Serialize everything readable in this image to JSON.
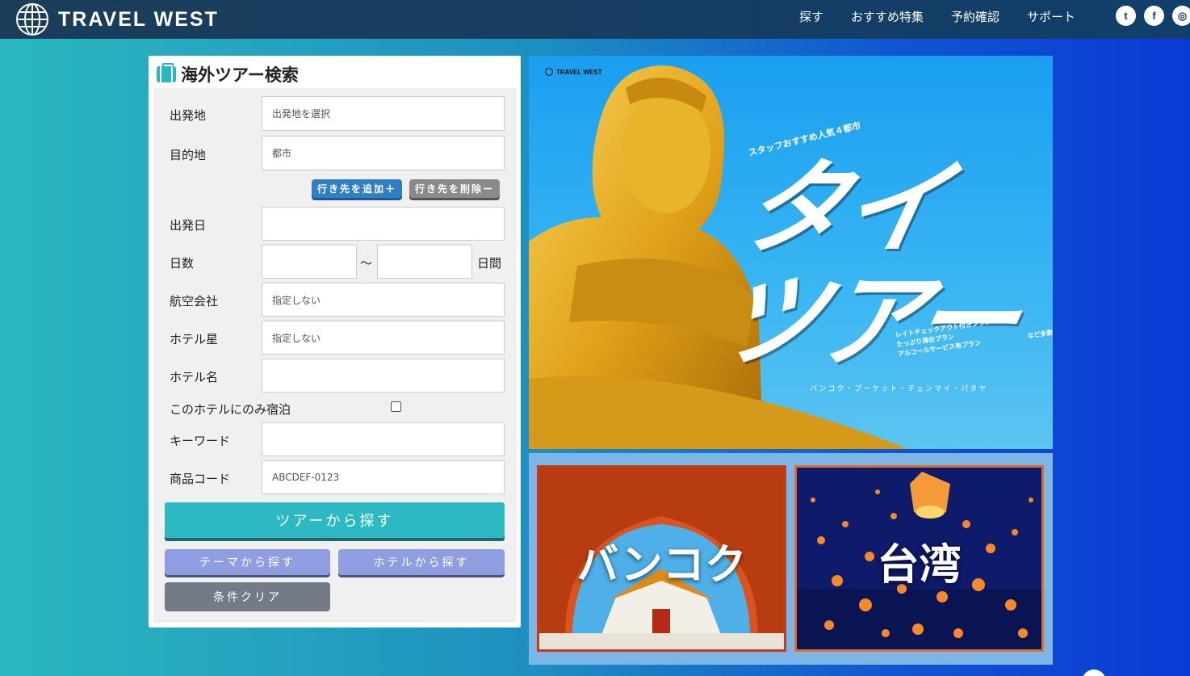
{
  "header": {
    "logo_text": "TRAVEL WEST",
    "nav": [
      "探す",
      "おすすめ特集",
      "予約確認",
      "サポート"
    ],
    "social": [
      {
        "icon": "twitter-icon",
        "glyph": "t"
      },
      {
        "icon": "facebook-icon",
        "glyph": "f"
      },
      {
        "icon": "instagram-icon",
        "glyph": "◎"
      }
    ]
  },
  "search": {
    "title": "海外ツアー検索",
    "departure_label": "出発地",
    "departure_placeholder": "出発地を選択",
    "destination_label": "目的地",
    "destination_placeholder": "都市",
    "add_destination": "行き先を追加＋",
    "remove_destination": "行き先を削除ー",
    "date_label": "出発日",
    "days_label": "日数",
    "days_separator": "〜",
    "days_unit": "日間",
    "airline_label": "航空会社",
    "airline_placeholder": "指定しない",
    "hotel_star_label": "ホテル星",
    "hotel_star_placeholder": "指定しない",
    "hotel_name_label": "ホテル名",
    "hotel_only_label": "このホテルにのみ宿泊",
    "keyword_label": "キーワード",
    "product_code_label": "商品コード",
    "product_code_placeholder": "ABCDEF-0123",
    "search_tour": "ツアーから探す",
    "search_theme": "テーマから探す",
    "search_hotel": "ホテルから探す",
    "clear": "条件クリア"
  },
  "hero": {
    "logo": "TRAVEL WEST",
    "subtitle": "スタッフおすすめ人気４都市",
    "title_line1": "タイ",
    "title_line2": "ツアー",
    "plans": [
      "レイトチェックアウト付きプラン",
      "たっぷり滞在プラン",
      "アルコールサービス有プラン"
    ],
    "plans_note": "など多数掲載中",
    "cities": "バンコク・プーケット・チェンマイ・パタヤ"
  },
  "cards": {
    "bangkok": "バンコク",
    "taiwan": "台湾"
  }
}
